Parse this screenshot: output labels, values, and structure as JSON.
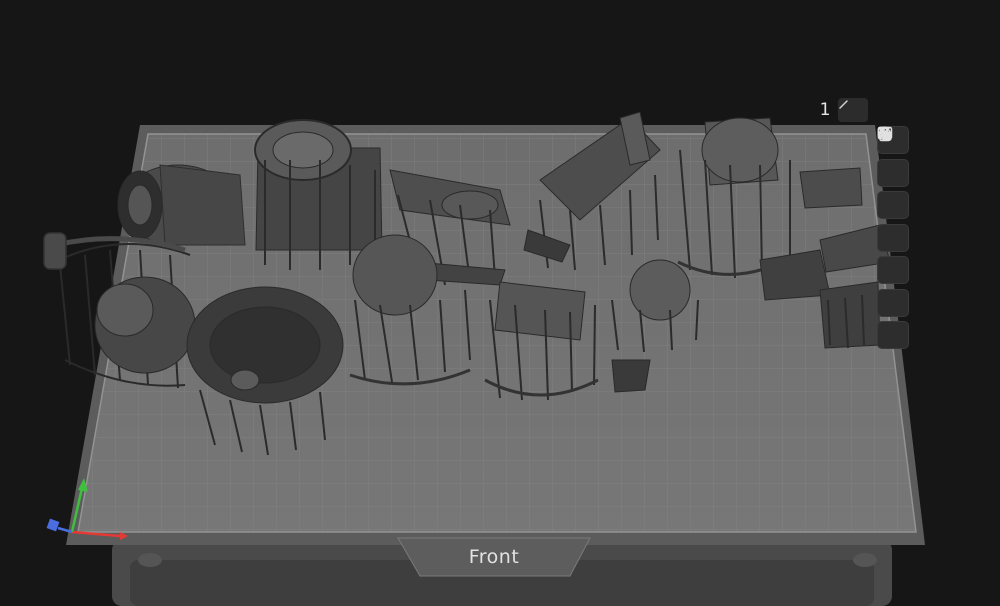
{
  "viewport": {
    "object_count": "1",
    "front_label": "Front",
    "background_color": "#161616",
    "plate_color": "#6b6b6b",
    "grid_color": "#858585"
  },
  "toolbar": {
    "items": [
      {
        "icon": "close-icon"
      },
      {
        "icon": "rotate-view-icon"
      },
      {
        "icon": "layout-icon"
      },
      {
        "icon": "duplicate-icon"
      },
      {
        "icon": "unlock-icon"
      },
      {
        "icon": "supports-icon"
      },
      {
        "icon": "add-icon"
      }
    ]
  },
  "axes": {
    "x_color": "#e53935",
    "y_color": "#3fbf3f",
    "z_color": "#4a6ee0"
  }
}
